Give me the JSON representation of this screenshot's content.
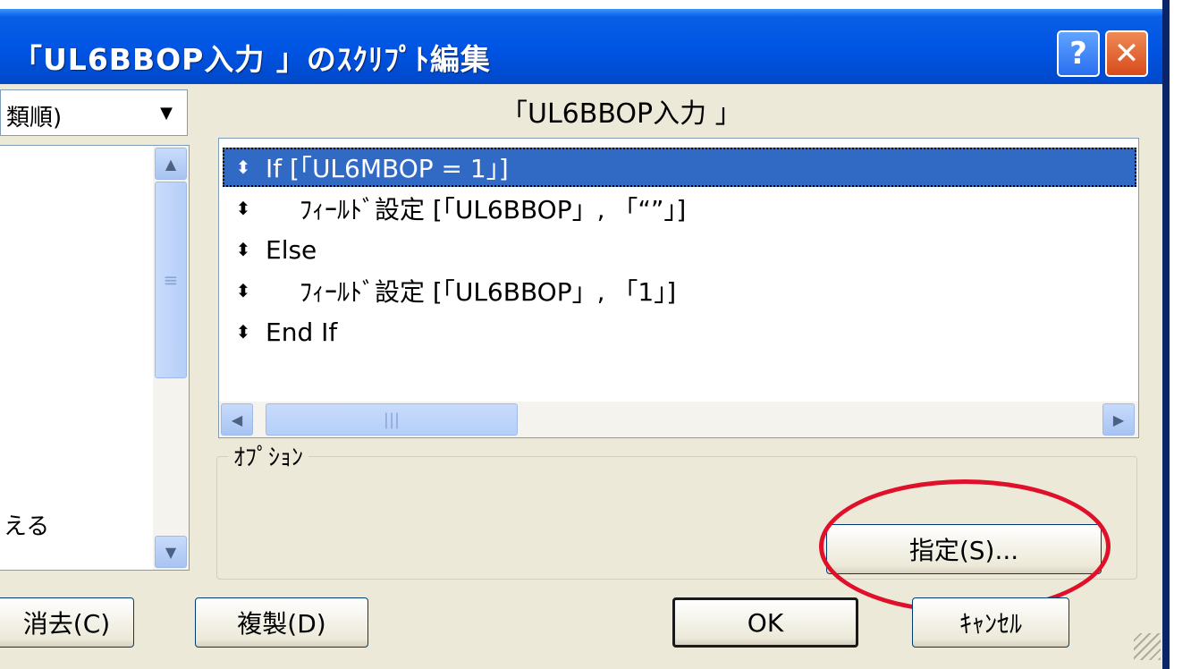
{
  "window": {
    "title": "「UL6BBOP入力 」のｽｸﾘﾌﾟﾄ編集",
    "help_glyph": "?",
    "close_glyph": "✕"
  },
  "left": {
    "combo_value": "類順)",
    "list_item_partial": "える"
  },
  "script": {
    "heading": "「UL6BBOP入力 」",
    "lines": [
      {
        "text": "If [「UL6MBOP = 1」]",
        "indent": false,
        "selected": true
      },
      {
        "text": "ﾌｨｰﾙﾄﾞ設定 [「UL6BBOP」, 「“”」]",
        "indent": true,
        "selected": false
      },
      {
        "text": "Else",
        "indent": false,
        "selected": false
      },
      {
        "text": "ﾌｨｰﾙﾄﾞ設定 [「UL6BBOP」, 「1」]",
        "indent": true,
        "selected": false
      },
      {
        "text": "End If",
        "indent": false,
        "selected": false
      }
    ],
    "bullet": "⬍"
  },
  "options": {
    "label": "ｵﾌﾟｼｮﾝ",
    "specify_label": "指定(S)..."
  },
  "buttons": {
    "clear_label": "消去(C)",
    "duplicate_label": "複製(D)",
    "ok_label": "OK",
    "cancel_label": "ｷｬﾝｾﾙ"
  },
  "colors": {
    "titlebar": "#0054e3",
    "selection": "#316ac5",
    "highlight_circle": "#e0102a",
    "dialog_bg": "#ece9d8"
  }
}
